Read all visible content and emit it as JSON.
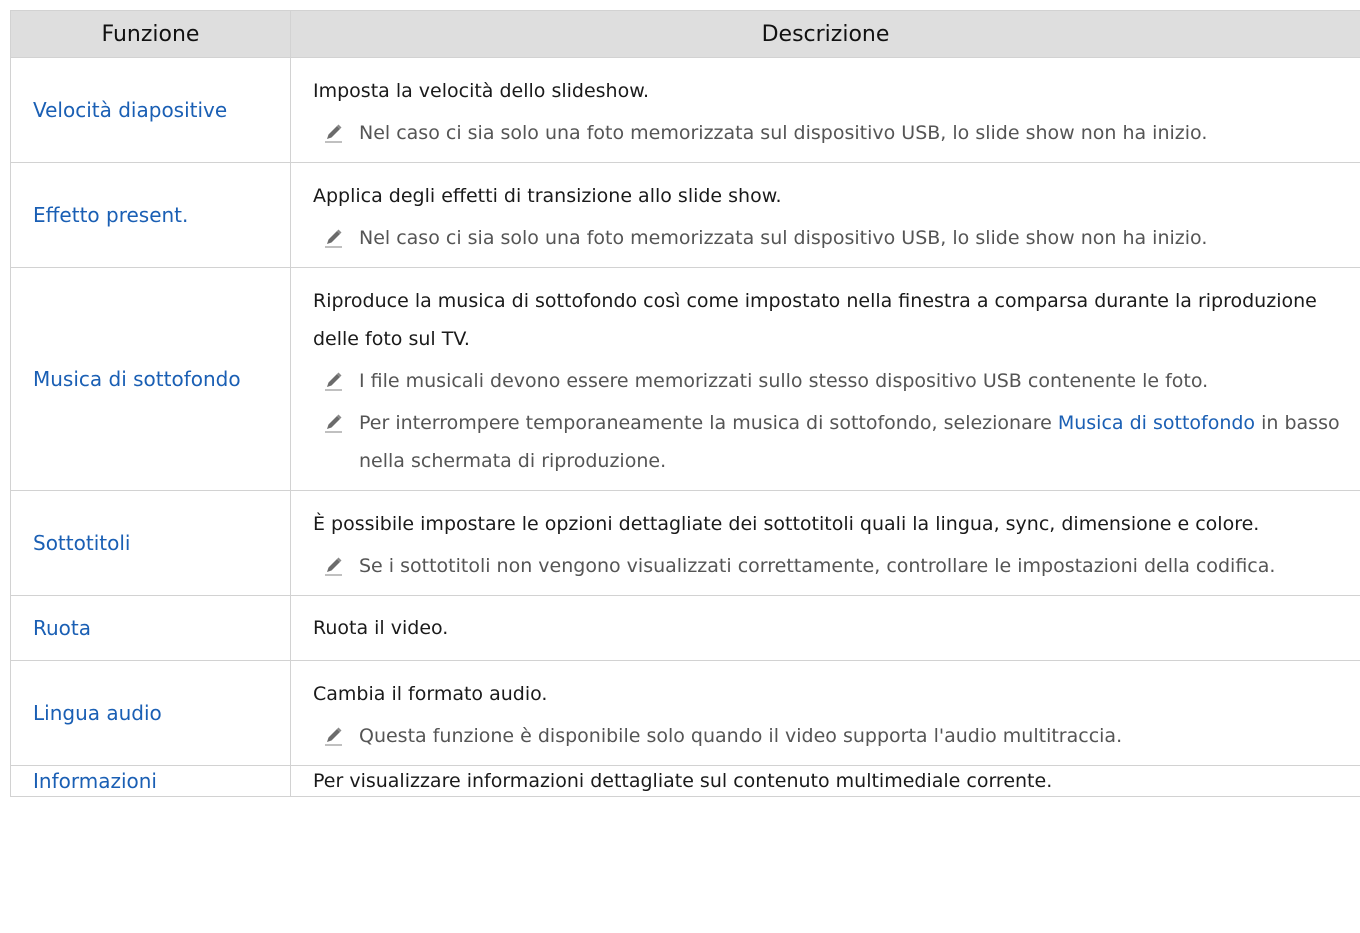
{
  "table": {
    "headers": {
      "function": "Funzione",
      "description": "Descrizione"
    },
    "rows": [
      {
        "name": "Velocità diapositive",
        "description": "Imposta la velocità dello slideshow.",
        "notes": [
          "Nel caso ci sia solo una foto memorizzata sul dispositivo USB, lo slide show non ha inizio."
        ]
      },
      {
        "name": "Effetto present.",
        "description": "Applica degli effetti di transizione allo slide show.",
        "notes": [
          "Nel caso ci sia solo una foto memorizzata sul dispositivo USB, lo slide show non ha inizio."
        ]
      },
      {
        "name": "Musica di sottofondo",
        "description": "Riproduce la musica di sottofondo così come impostato nella finestra a comparsa durante la riproduzione delle foto sul TV.",
        "notes": [
          "I file musicali devono essere memorizzati sullo stesso dispositivo USB contenente le foto.",
          {
            "before": "Per interrompere temporaneamente la musica di sottofondo, selezionare ",
            "link": "Musica di sottofondo",
            "after": " in basso nella schermata di riproduzione."
          }
        ]
      },
      {
        "name": "Sottotitoli",
        "description": "È possibile impostare le opzioni dettagliate dei sottotitoli quali la lingua, sync, dimensione e colore.",
        "notes": [
          "Se i sottotitoli non vengono visualizzati correttamente, controllare le impostazioni della codifica."
        ]
      },
      {
        "name": "Ruota",
        "description": "Ruota il video.",
        "notes": []
      },
      {
        "name": "Lingua audio",
        "description": "Cambia il formato audio.",
        "notes": [
          "Questa funzione è disponibile solo quando il video supporta l'audio multitraccia."
        ]
      },
      {
        "name": "Informazioni",
        "description": "Per visualizzare informazioni dettagliate sul contenuto multimediale corrente.",
        "notes": []
      }
    ]
  },
  "icons": {
    "note": "pencil-note-icon"
  },
  "colors": {
    "link": "#1a5fb4",
    "header_bg": "#dedede",
    "note_text": "#555555"
  }
}
